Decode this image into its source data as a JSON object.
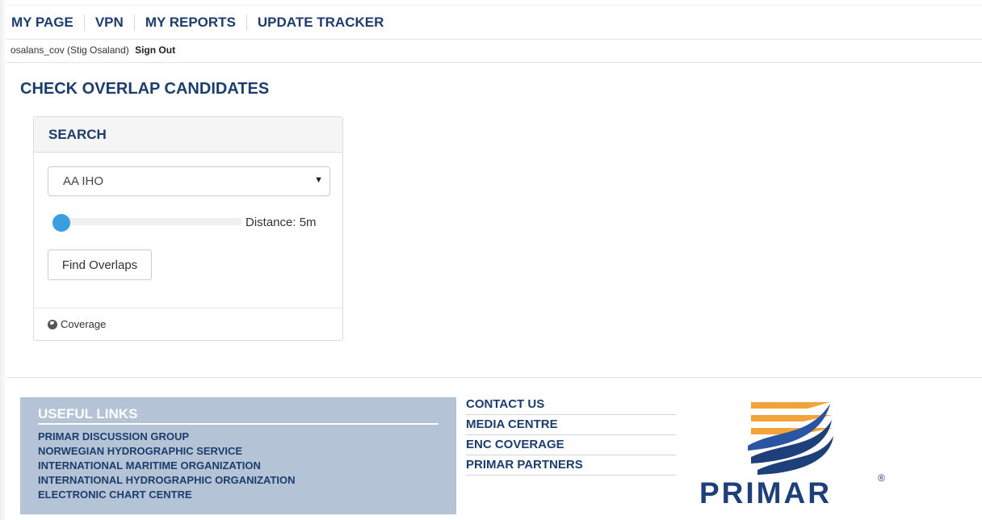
{
  "nav": {
    "items": [
      {
        "label": "MY PAGE"
      },
      {
        "label": "VPN"
      },
      {
        "label": "MY REPORTS"
      },
      {
        "label": "UPDATE TRACKER"
      }
    ]
  },
  "user": {
    "name": "osalans_cov (Stig Osaland)",
    "signout_label": "Sign Out"
  },
  "page": {
    "title": "CHECK OVERLAP CANDIDATES"
  },
  "search": {
    "header": "SEARCH",
    "select_value": "AA IHO",
    "distance_label": "Distance: 5m",
    "slider_value_fraction": 0.0,
    "button_label": "Find Overlaps",
    "footer_link": "Coverage"
  },
  "footer": {
    "useful_links_title": "USEFUL LINKS",
    "useful_links": [
      "PRIMAR DISCUSSION GROUP",
      "NORWEGIAN HYDROGRAPHIC SERVICE",
      "INTERNATIONAL MARITIME ORGANIZATION",
      "INTERNATIONAL HYDROGRAPHIC ORGANIZATION",
      "ELECTRONIC CHART CENTRE"
    ],
    "right_links": [
      "CONTACT US",
      "MEDIA CENTRE",
      "ENC COVERAGE",
      "PRIMAR PARTNERS"
    ],
    "logo_text": "PRIMAR",
    "logo_reg": "®"
  },
  "colors": {
    "brand_navy": "#1d3d6c",
    "slider_blue": "#3a9ee0",
    "links_box_bg": "#b5c3d6",
    "logo_orange": "#f2a33a"
  }
}
